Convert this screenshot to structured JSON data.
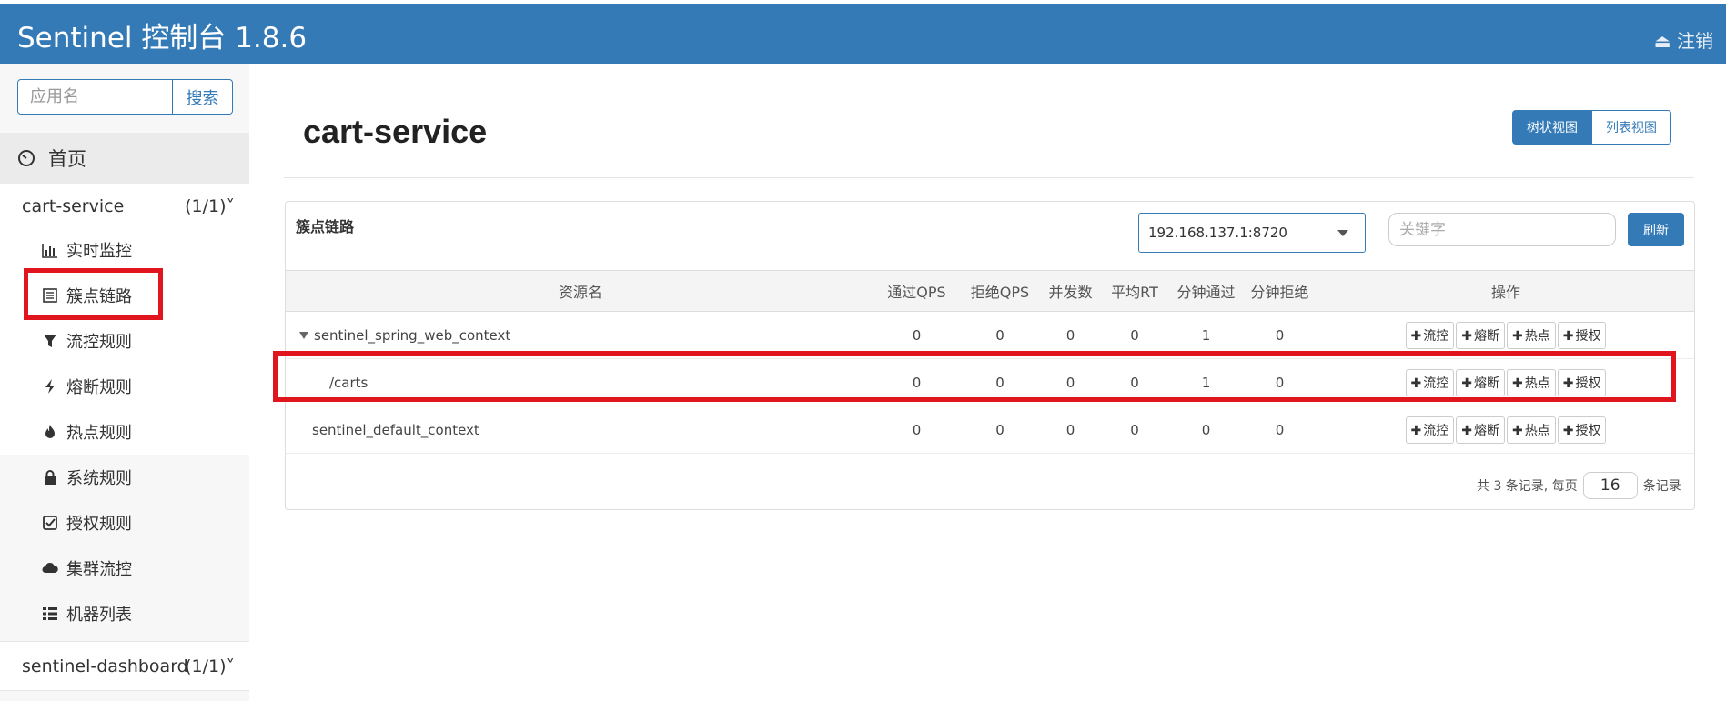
{
  "header": {
    "title": "Sentinel 控制台 1.8.6",
    "logout_label": "注销"
  },
  "sidebar": {
    "search_placeholder": "应用名",
    "search_button": "搜索",
    "home_label": "首页",
    "apps": [
      {
        "name": "cart-service",
        "count": "(1/1)"
      },
      {
        "name": "sentinel-dashboard",
        "count": "(1/1)"
      }
    ],
    "items": [
      {
        "label": "实时监控",
        "icon": "bar-chart-icon"
      },
      {
        "label": "簇点链路",
        "icon": "list-icon"
      },
      {
        "label": "流控规则",
        "icon": "filter-icon"
      },
      {
        "label": "熔断规则",
        "icon": "flash-icon"
      },
      {
        "label": "热点规则",
        "icon": "fire-icon"
      },
      {
        "label": "系统规则",
        "icon": "lock-icon"
      },
      {
        "label": "授权规则",
        "icon": "check-icon"
      },
      {
        "label": "集群流控",
        "icon": "cloud-icon"
      },
      {
        "label": "机器列表",
        "icon": "th-list-icon"
      }
    ]
  },
  "main": {
    "title": "cart-service",
    "view_tree": "树状视图",
    "view_list": "列表视图",
    "panel_title": "簇点链路",
    "machine": "192.168.137.1:8720",
    "keyword_placeholder": "关键字",
    "refresh": "刷新",
    "columns": [
      "资源名",
      "通过QPS",
      "拒绝QPS",
      "并发数",
      "平均RT",
      "分钟通过",
      "分钟拒绝",
      "操作"
    ],
    "rows": [
      {
        "name": "sentinel_spring_web_context",
        "pass_qps": "0",
        "block_qps": "0",
        "concurrency": "0",
        "avg_rt": "0",
        "min_pass": "1",
        "min_block": "0"
      },
      {
        "name": "/carts",
        "pass_qps": "0",
        "block_qps": "0",
        "concurrency": "0",
        "avg_rt": "0",
        "min_pass": "1",
        "min_block": "0"
      },
      {
        "name": "sentinel_default_context",
        "pass_qps": "0",
        "block_qps": "0",
        "concurrency": "0",
        "avg_rt": "0",
        "min_pass": "0",
        "min_block": "0"
      }
    ],
    "ops": {
      "flow": "流控",
      "degrade": "熔断",
      "hot": "热点",
      "auth": "授权"
    },
    "pager": {
      "prefix": "共 3 条记录, 每页",
      "page_size": "16",
      "suffix": "条记录"
    }
  },
  "colors": {
    "brand": "#337ab7",
    "highlight": "#e0151d"
  }
}
